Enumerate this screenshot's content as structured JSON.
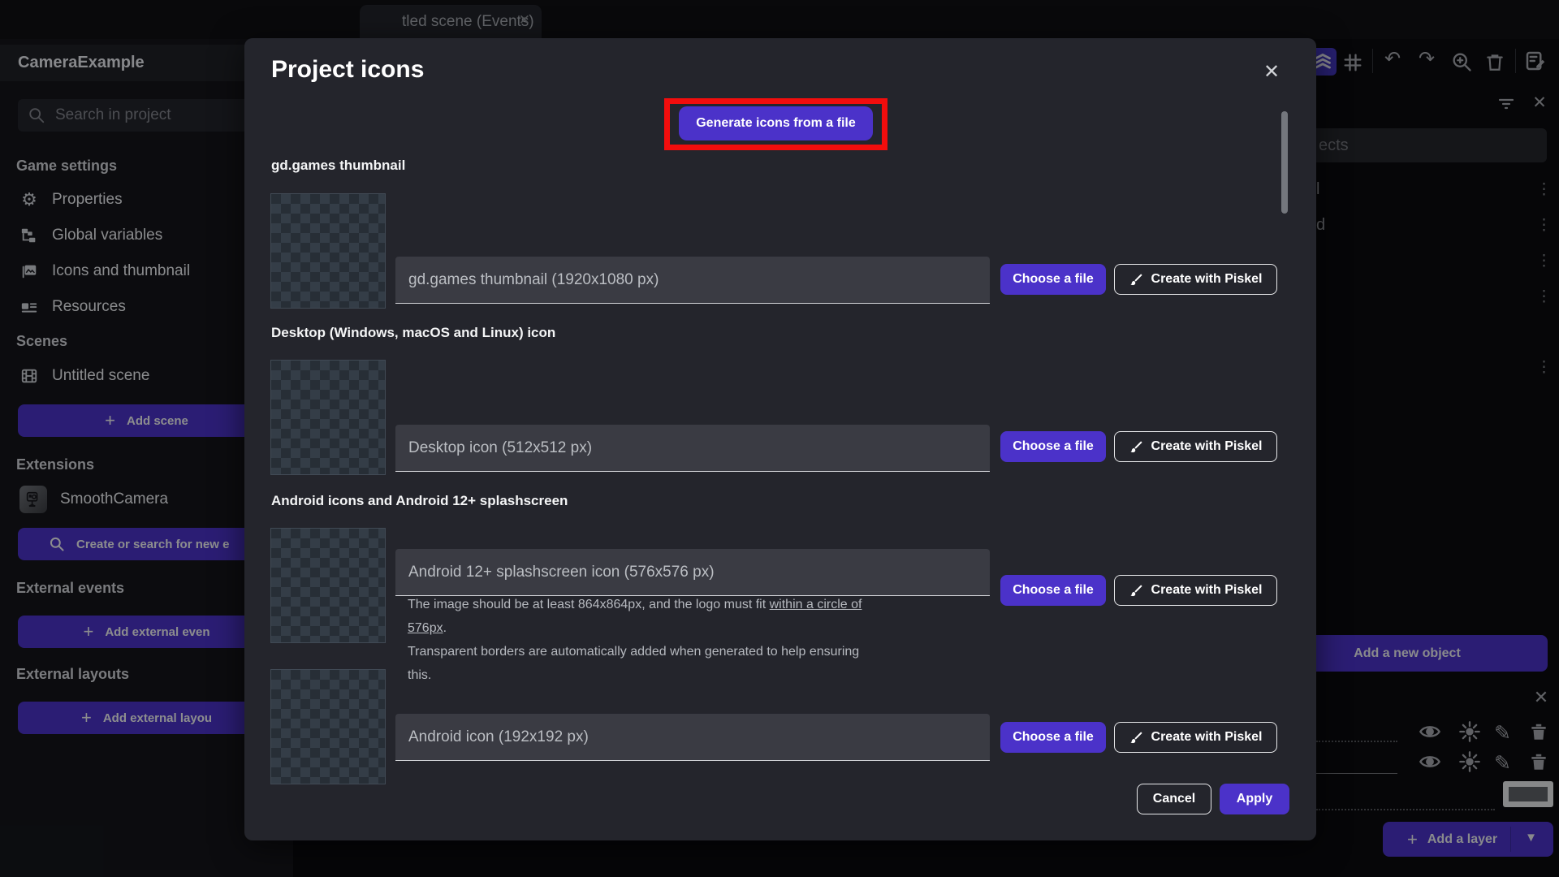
{
  "app": {
    "tab_title": "tled scene (Events)",
    "close_glyph": "✕"
  },
  "sidebar": {
    "title": "CameraExample",
    "search_placeholder": "Search in project",
    "game_settings_header": "Game settings",
    "items": [
      {
        "label": "Properties"
      },
      {
        "label": "Global variables"
      },
      {
        "label": "Icons and thumbnail"
      },
      {
        "label": "Resources"
      }
    ],
    "scenes_header": "Scenes",
    "scene_item": "Untitled scene",
    "add_scene_label": "Add scene",
    "extensions_header": "Extensions",
    "extension_item": "SmoothCamera",
    "search_extensions_label": "Create or search for new e",
    "external_events_header": "External events",
    "add_external_events_label": "Add external even",
    "external_layouts_header": "External layouts",
    "add_external_layouts_label": "Add external layou"
  },
  "modal": {
    "title": "Project icons",
    "generate_button_label": "Generate icons from a file",
    "choose_file_label": "Choose a file",
    "create_piskel_label": "Create with Piskel",
    "cancel_label": "Cancel",
    "apply_label": "Apply",
    "sections": [
      {
        "label": "gd.games thumbnail",
        "placeholder": "gd.games thumbnail (1920x1080 px)"
      },
      {
        "label": "Desktop (Windows, macOS and Linux) icon",
        "placeholder": "Desktop icon (512x512 px)"
      },
      {
        "label": "Android icons and Android 12+ splashscreen",
        "placeholder": "Android 12+ splashscreen icon (576x576 px)",
        "note_line1_before": "The image should be at least 864x864px, and the logo must fit ",
        "note_line1_link": "within a circle of 576px",
        "note_line1_after": ".",
        "note_line2": "Transparent borders are automatically added when generated to help ensuring this."
      },
      {
        "placeholder": "Android icon (192x192 px)"
      }
    ]
  },
  "right_panel": {
    "objects_search_fragment": "ects",
    "object_row_fragments": [
      "l",
      "d"
    ],
    "add_new_object_label": "Add a new object",
    "add_layer_label": "Add a layer"
  },
  "colors": {
    "accent_purple": "#4b32c9",
    "highlight_red": "#f20d0d"
  }
}
